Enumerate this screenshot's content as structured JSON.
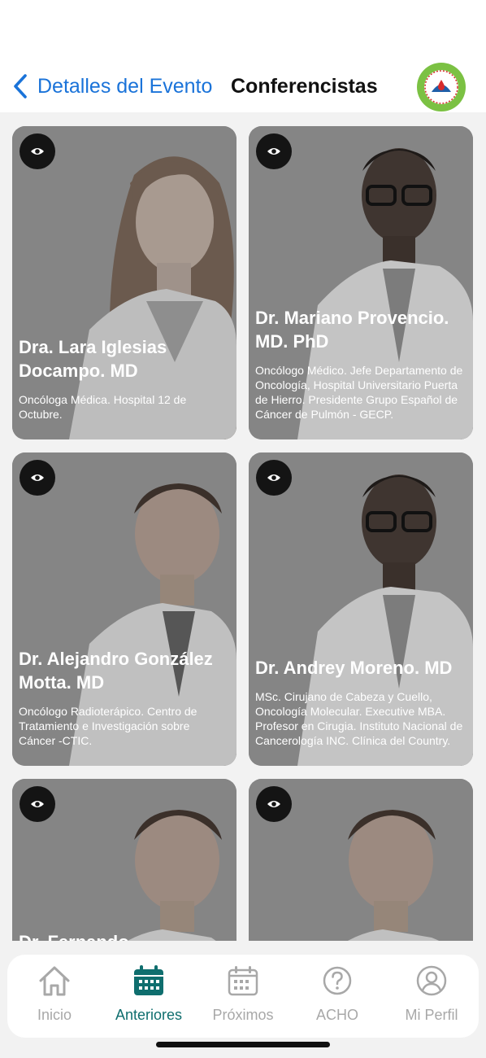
{
  "header": {
    "back_label": "Detalles del Evento",
    "title": "Conferencistas",
    "logo_icon": "organization-seal-logo"
  },
  "speakers": [
    {
      "name": "Dra. Lara Iglesias Docampo. MD",
      "description": "Oncóloga Médica. Hospital 12 de Octubre.",
      "action_icon": "eye-icon"
    },
    {
      "name": "Dr. Mariano Provencio. MD. PhD",
      "description": "Oncólogo Médico. Jefe Departamento de Oncología, Hospital Universitario Puerta de Hierro. Presidente Grupo Español de Cáncer de Pulmón - GECP.",
      "action_icon": "eye-icon"
    },
    {
      "name": "Dr. Alejandro González Motta. MD",
      "description": "Oncólogo Radioterápico. Centro de Tratamiento e Investigación sobre Cáncer -CTIC.",
      "action_icon": "eye-icon"
    },
    {
      "name": "Dr. Andrey Moreno. MD",
      "description": "MSc. Cirujano de Cabeza y Cuello, Oncología Molecular. Executive MBA. Profesor en Cirugia. Instituto Nacional de Cancerología INC. Clínica del Country.",
      "action_icon": "eye-icon"
    },
    {
      "name": "Dr. Fernando",
      "description": "",
      "action_icon": "eye-icon"
    },
    {
      "name": "",
      "description": "",
      "action_icon": "eye-icon"
    }
  ],
  "tabs": [
    {
      "label": "Inicio",
      "icon": "home-icon",
      "active": false
    },
    {
      "label": "Anteriores",
      "icon": "calendar-icon",
      "active": true
    },
    {
      "label": "Próximos",
      "icon": "calendar-icon",
      "active": false
    },
    {
      "label": "ACHO",
      "icon": "question-circle-icon",
      "active": false
    },
    {
      "label": "Mi Perfil",
      "icon": "user-circle-icon",
      "active": false
    }
  ],
  "colors": {
    "accent_blue": "#1a73d9",
    "active_tab": "#0f6e6e",
    "inactive_tab": "#a8a8a8",
    "card_overlay": "#878787",
    "logo_green": "#7bc143"
  }
}
